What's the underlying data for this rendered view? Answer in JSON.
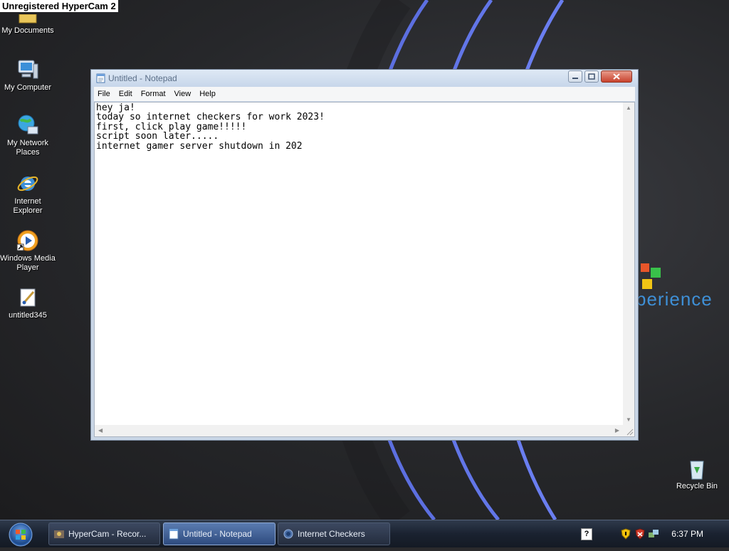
{
  "watermark": "Unregistered HyperCam 2",
  "desktop_icons": [
    {
      "label": "My Documents",
      "icon": "folder-icon"
    },
    {
      "label": "My Computer",
      "icon": "computer-icon"
    },
    {
      "label_lines": [
        "My Network",
        "Places"
      ],
      "icon": "network-icon"
    },
    {
      "label_lines": [
        "Internet",
        "Explorer"
      ],
      "icon": "internet-explorer-icon"
    },
    {
      "label_lines": [
        "Windows Media",
        "Player"
      ],
      "icon": "media-player-icon"
    },
    {
      "label": "untitled345",
      "icon": "paint-file-icon"
    },
    {
      "label": "Recycle Bin",
      "icon": "recycle-bin-icon"
    }
  ],
  "wallpaper_text": "perience",
  "notepad": {
    "title": "Untitled - Notepad",
    "menu": [
      "File",
      "Edit",
      "Format",
      "View",
      "Help"
    ],
    "content": "hey ja!\ntoday so internet checkers for work 2023!\nfirst, click play game!!!!!\nscript soon later.....\ninternet gamer server shutdown in 202"
  },
  "taskbar": {
    "tasks": [
      {
        "label": "HyperCam - Recor...",
        "icon": "hypercam-icon",
        "active": false
      },
      {
        "label": "Untitled - Notepad",
        "icon": "notepad-icon",
        "active": true
      },
      {
        "label": "Internet Checkers",
        "icon": "checkers-icon",
        "active": false
      }
    ],
    "tray_help_glyph": "?",
    "clock": "6:37 PM"
  },
  "colors": {
    "taskbar": "#1a2230",
    "active_task": "#2e4b7e",
    "window_frame": "#c9d6e6",
    "accent_blue": "#3e8fd6"
  }
}
